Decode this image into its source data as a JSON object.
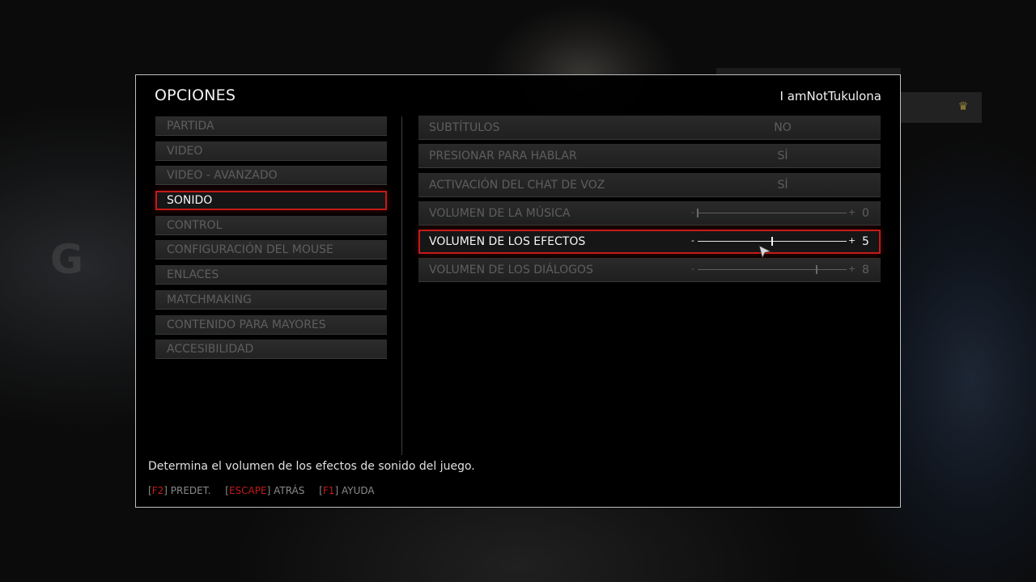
{
  "header": {
    "title": "OPCIONES",
    "username": "I amNotTukulona"
  },
  "sidebar": {
    "items": [
      {
        "label": "PARTIDA"
      },
      {
        "label": "VIDEO"
      },
      {
        "label": "VIDEO - AVANZADO"
      },
      {
        "label": "SONIDO",
        "active": true
      },
      {
        "label": "CONTROL"
      },
      {
        "label": "CONFIGURACIÓN DEL MOUSE"
      },
      {
        "label": "ENLACES"
      },
      {
        "label": "MATCHMAKING"
      },
      {
        "label": "CONTENIDO PARA MAYORES"
      },
      {
        "label": "ACCESIBILIDAD"
      }
    ]
  },
  "settings": {
    "rows": [
      {
        "label": "SUBTÍTULOS",
        "value": "NO"
      },
      {
        "label": "PRESIONAR PARA HABLAR",
        "value": "SÍ"
      },
      {
        "label": "ACTIVACIÓN DEL CHAT DE VOZ",
        "value": "SÍ"
      },
      {
        "label": "VOLUMEN DE LA MÚSICA",
        "slider_value": "0",
        "slider_fraction": 0.0
      },
      {
        "label": "VOLUMEN DE LOS EFECTOS",
        "slider_value": "5",
        "slider_fraction": 0.5,
        "active": true
      },
      {
        "label": "VOLUMEN DE LOS DIÁLOGOS",
        "slider_value": "8",
        "slider_fraction": 0.8
      }
    ],
    "slider_minus": "-",
    "slider_plus": "+"
  },
  "description": "Determina el volumen de los efectos de sonido del juego.",
  "footer": {
    "hints": [
      {
        "key": "F2",
        "label": "PREDET."
      },
      {
        "key": "ESCAPE",
        "label": "ATRÁS"
      },
      {
        "key": "F1",
        "label": "AYUDA"
      }
    ]
  },
  "colors": {
    "accent": "#c41a1a",
    "text_active": "#f4f4f4",
    "text_inactive": "#5e5e5e"
  },
  "icons": {
    "cursor": "mouse-cursor-icon",
    "crown": "crown-icon"
  }
}
